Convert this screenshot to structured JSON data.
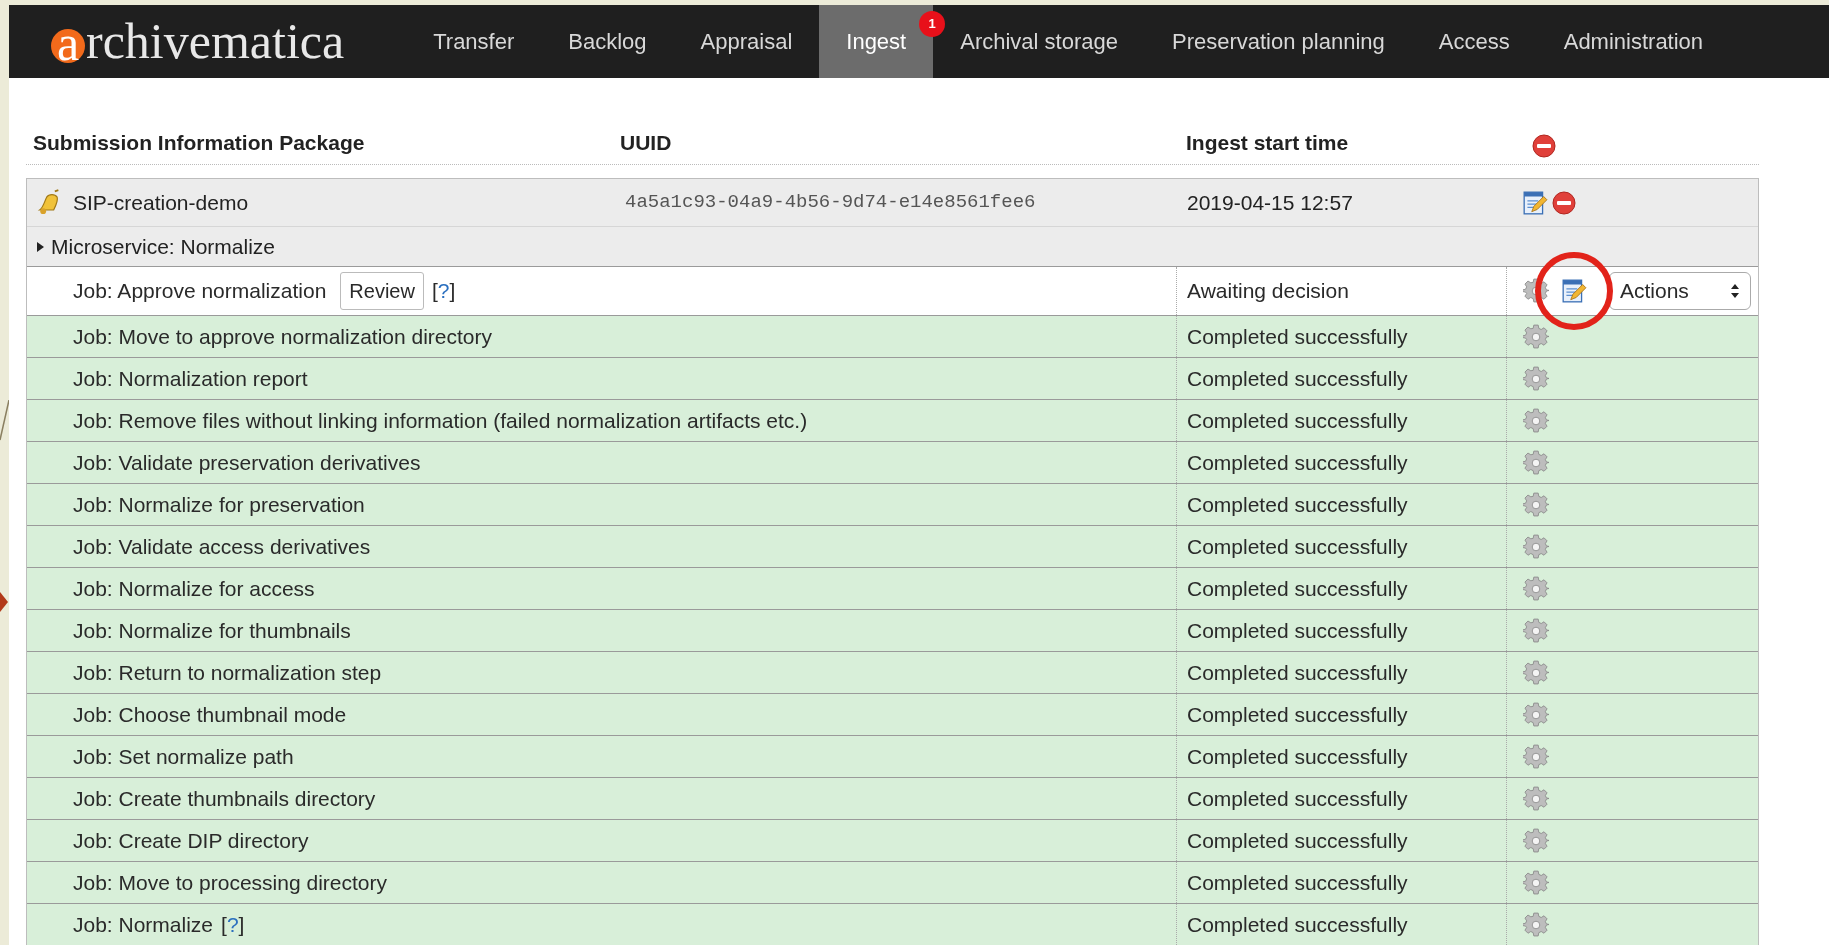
{
  "logo": {
    "initial": "a",
    "rest": "rchivematica"
  },
  "nav": [
    {
      "label": "Transfer",
      "selected": false
    },
    {
      "label": "Backlog",
      "selected": false
    },
    {
      "label": "Appraisal",
      "selected": false
    },
    {
      "label": "Ingest",
      "selected": true,
      "badge": "1"
    },
    {
      "label": "Archival storage",
      "selected": false
    },
    {
      "label": "Preservation planning",
      "selected": false
    },
    {
      "label": "Access",
      "selected": false
    },
    {
      "label": "Administration",
      "selected": false
    }
  ],
  "table": {
    "columns": [
      "Submission Information Package",
      "UUID",
      "Ingest start time"
    ],
    "sip": {
      "name": "SIP-creation-demo",
      "uuid": "4a5a1c93-04a9-4b56-9d74-e14e8561fee6",
      "start_time": "2019-04-15 12:57"
    },
    "microservice": {
      "label": "Microservice: Normalize",
      "expanded": false
    },
    "jobs": [
      {
        "kind": "decision",
        "label": "Job: Approve normalization",
        "button": "Review",
        "help": {
          "open": "[",
          "mark": "?",
          "close": "]"
        },
        "status": "Awaiting decision",
        "actions": "Actions",
        "highlighted": true
      },
      {
        "kind": "done",
        "label": "Job: Move to approve normalization directory",
        "status": "Completed successfully"
      },
      {
        "kind": "done",
        "label": "Job: Normalization report",
        "status": "Completed successfully"
      },
      {
        "kind": "done",
        "label": "Job: Remove files without linking information (failed normalization artifacts etc.)",
        "status": "Completed successfully"
      },
      {
        "kind": "done",
        "label": "Job: Validate preservation derivatives",
        "status": "Completed successfully"
      },
      {
        "kind": "done",
        "label": "Job: Normalize for preservation",
        "status": "Completed successfully"
      },
      {
        "kind": "done",
        "label": "Job: Validate access derivatives",
        "status": "Completed successfully"
      },
      {
        "kind": "done",
        "label": "Job: Normalize for access",
        "status": "Completed successfully"
      },
      {
        "kind": "done",
        "label": "Job: Normalize for thumbnails",
        "status": "Completed successfully"
      },
      {
        "kind": "done",
        "label": "Job: Return to normalization step",
        "status": "Completed successfully"
      },
      {
        "kind": "done",
        "label": "Job: Choose thumbnail mode",
        "status": "Completed successfully"
      },
      {
        "kind": "done",
        "label": "Job: Set normalize path",
        "status": "Completed successfully"
      },
      {
        "kind": "done",
        "label": "Job: Create thumbnails directory",
        "status": "Completed successfully"
      },
      {
        "kind": "done",
        "label": "Job: Create DIP directory",
        "status": "Completed successfully"
      },
      {
        "kind": "done",
        "label": "Job: Move to processing directory",
        "status": "Completed successfully"
      },
      {
        "kind": "done",
        "label": "Job: Normalize",
        "help": {
          "open": "[",
          "mark": "?",
          "close": "]"
        },
        "status": "Completed successfully"
      }
    ]
  }
}
